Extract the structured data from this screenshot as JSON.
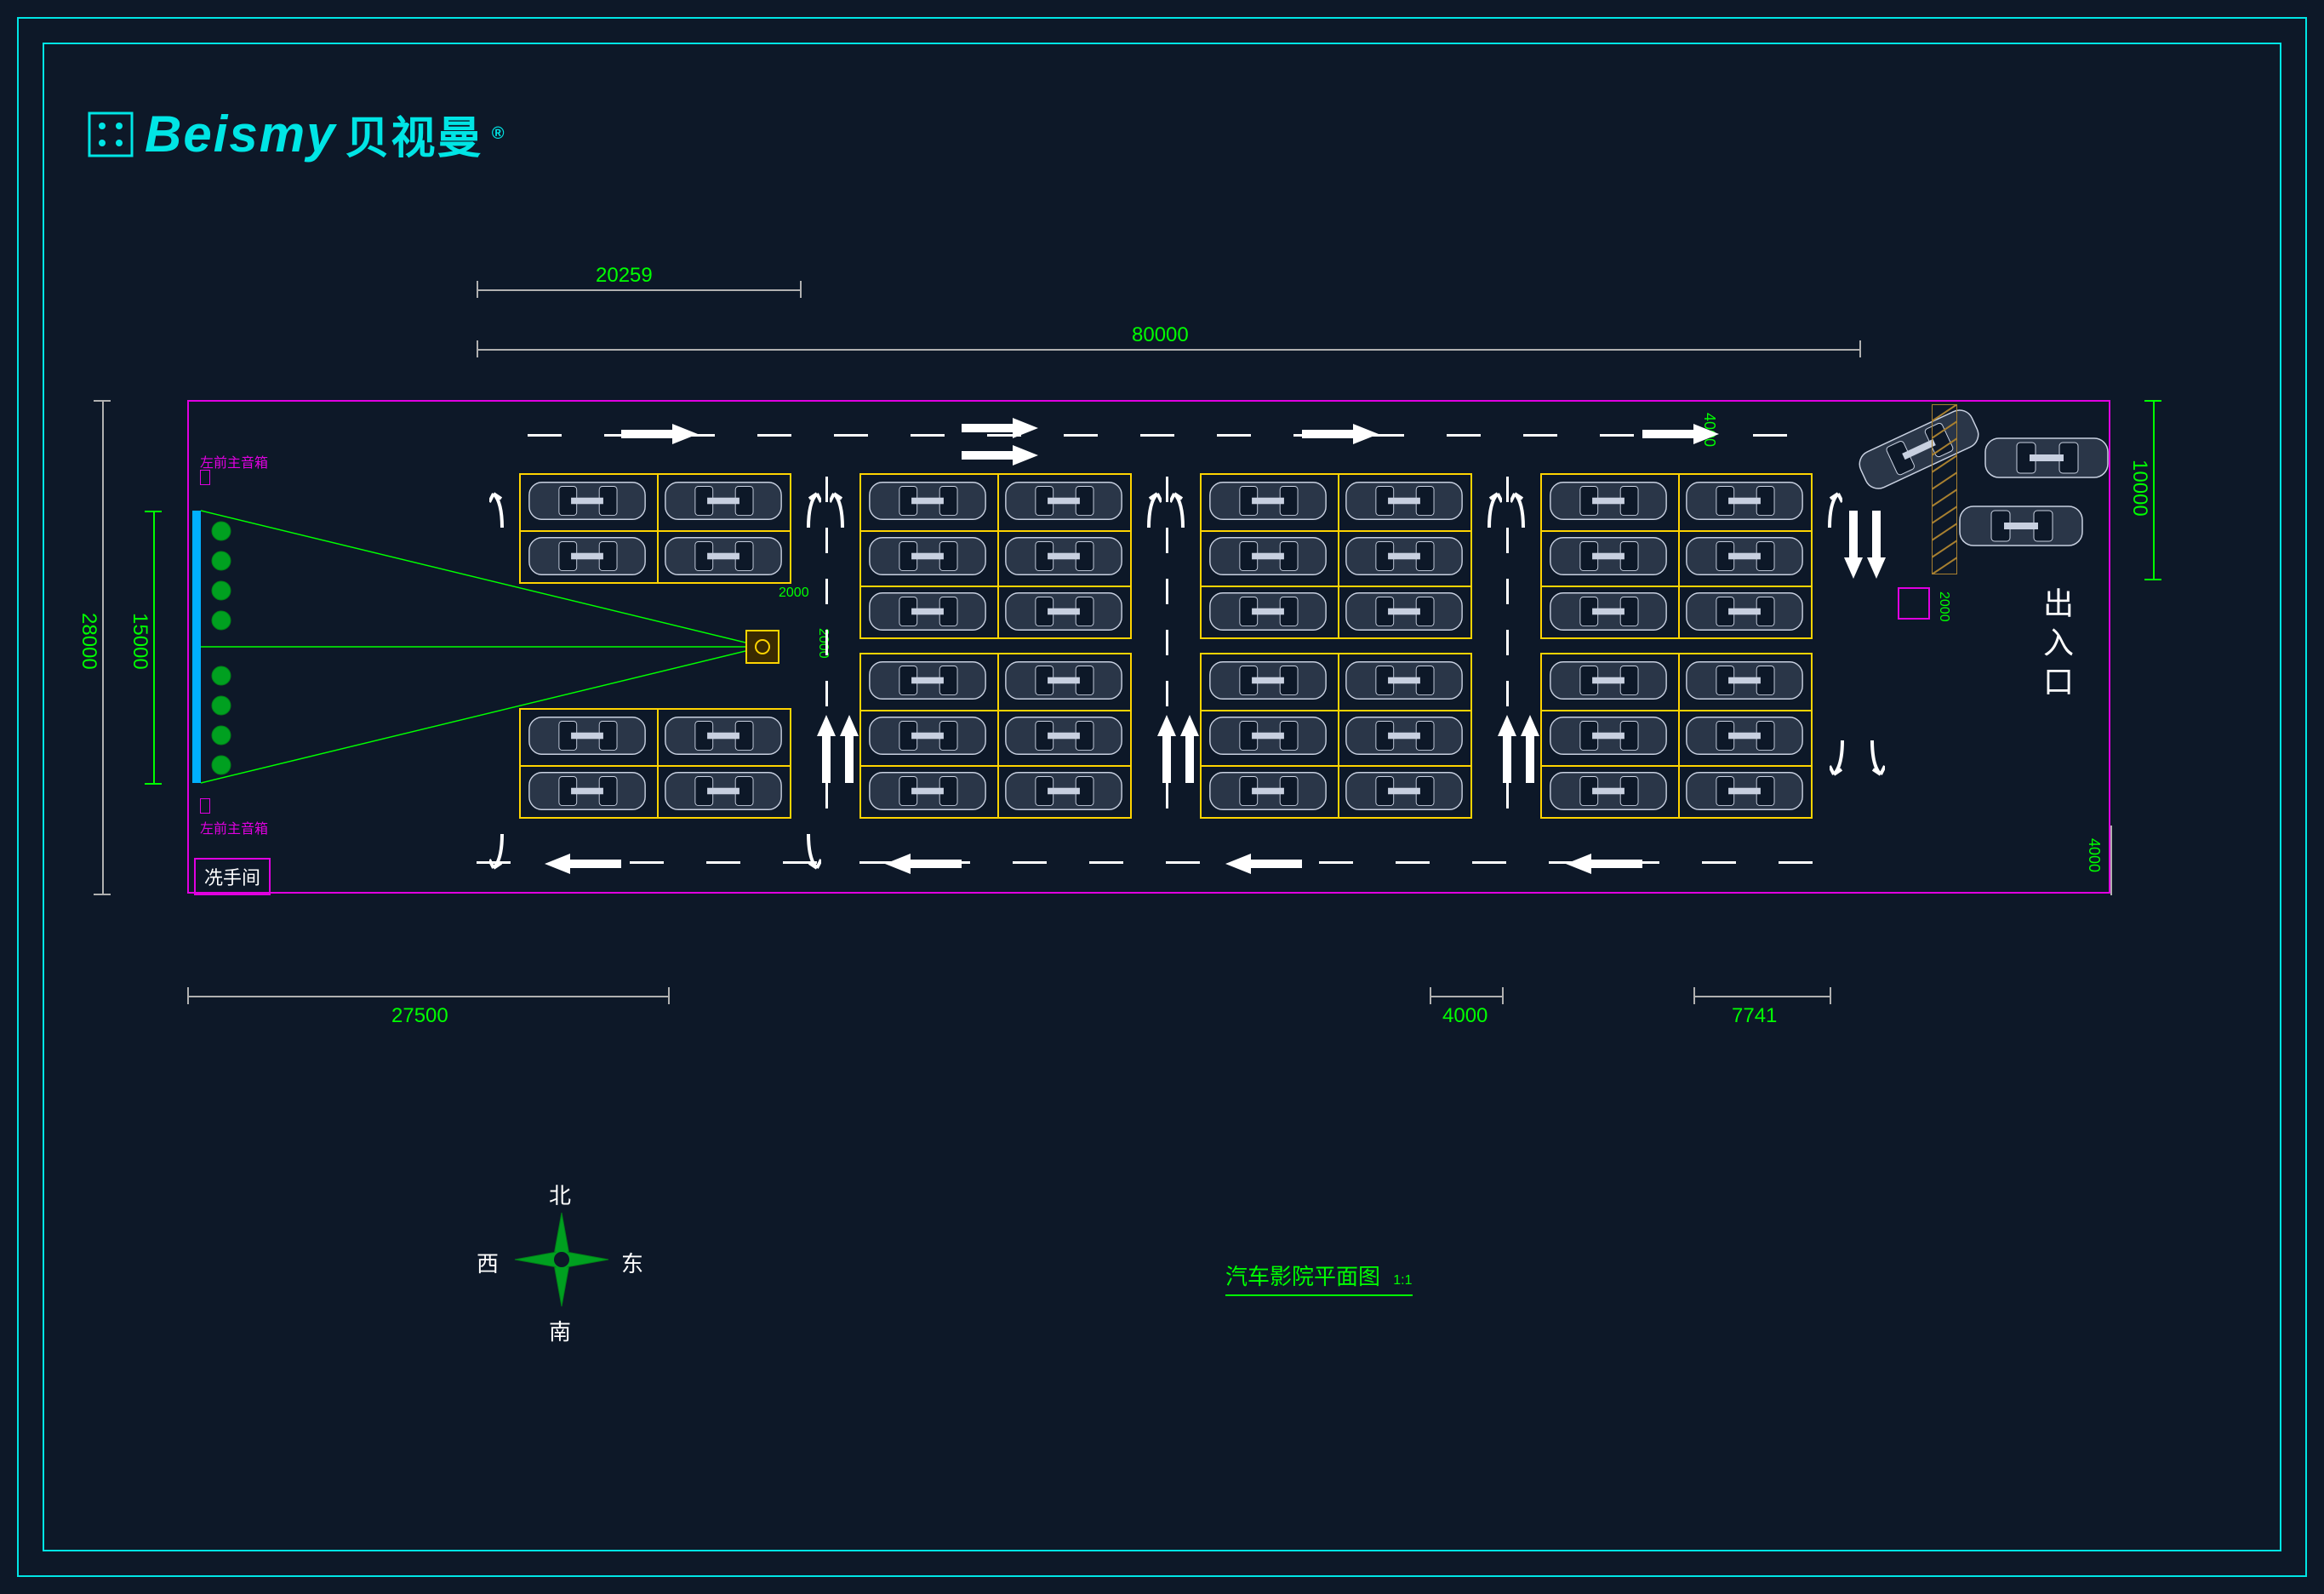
{
  "logo": {
    "latin": "Beismy",
    "cn": "贝视曼",
    "reg": "®"
  },
  "dimensions": {
    "top_partial": "20259",
    "top_full": "80000",
    "left_full": "28000",
    "left_screen": "15000",
    "bottom_left": "27500",
    "bottom_gap": "4000",
    "bottom_right": "7741",
    "right_top": "10000",
    "right_lane_top": "4000",
    "right_lane_bot": "4000",
    "slot_w": "2000",
    "slot_h": "2000",
    "booth_w": "2000"
  },
  "labels": {
    "speaker_tl": "左前主音箱",
    "speaker_bl": "左前主音箱",
    "restroom": "冼手间",
    "entrance": "出入口"
  },
  "compass": {
    "n": "北",
    "s": "南",
    "e": "东",
    "w": "西"
  },
  "title": {
    "text": "汽车影院平面图",
    "scale": "1:1"
  },
  "parking": {
    "columns": 4,
    "rows_per_col_each_side": [
      2,
      3,
      3,
      3
    ],
    "slots_per_row": 2
  }
}
